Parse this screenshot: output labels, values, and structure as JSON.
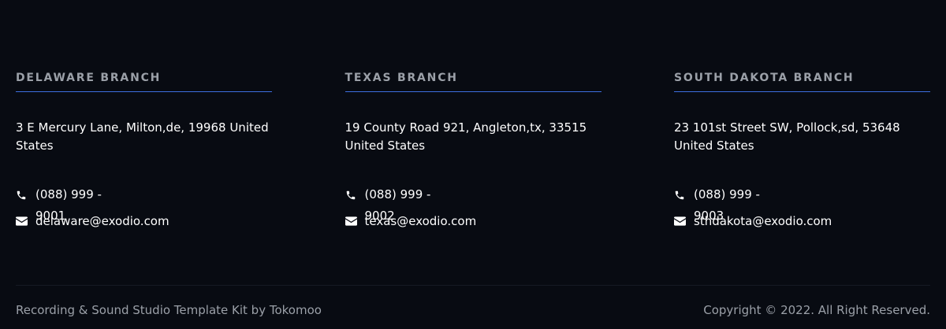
{
  "branches": [
    {
      "title": "DELAWARE BRANCH",
      "address": "3 E Mercury Lane, Milton,de, 19968 United States",
      "phone": "(088) 999 - 9001",
      "email": "delaware@exodio.com"
    },
    {
      "title": "TEXAS BRANCH",
      "address": "19 County Road 921, Angleton,tx, 33515 United States",
      "phone": "(088) 999 - 9002",
      "email": "texas@exodio.com"
    },
    {
      "title": "SOUTH DAKOTA BRANCH",
      "address": "23 101st Street SW, Pollock,sd, 53648 United States",
      "phone": "(088) 999 - 9003",
      "email": "sthdakota@exodio.com"
    }
  ],
  "footer": {
    "credit": "Recording & Sound Studio Template Kit by Tokomoo",
    "copyright": "Copyright © 2022. All Right Reserved."
  },
  "colors": {
    "background": "#080b12",
    "accent": "#3d6fe0",
    "muted_text": "#9ba0a8",
    "text": "#ffffff"
  },
  "icons": [
    "phone-icon",
    "envelope-icon"
  ]
}
